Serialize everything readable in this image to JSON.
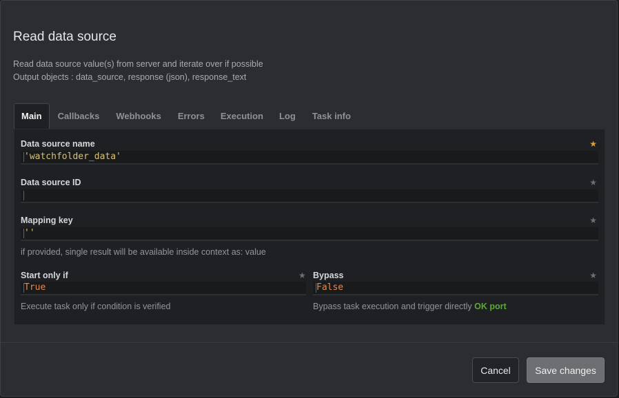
{
  "dialog": {
    "title": "Read data source",
    "description_line1": "Read data source value(s) from server and iterate over if possible",
    "description_line2": "Output objects : data_source, response (json), response_text"
  },
  "tabs": [
    "Main",
    "Callbacks",
    "Webhooks",
    "Errors",
    "Execution",
    "Log",
    "Task info"
  ],
  "fields": {
    "data_source_name": {
      "label": "Data source name",
      "value": "'watchfolder_data'"
    },
    "data_source_id": {
      "label": "Data source ID",
      "value": ""
    },
    "mapping_key": {
      "label": "Mapping key",
      "value": "''",
      "help": "if provided, single result will be available inside context as: value"
    },
    "start_only_if": {
      "label": "Start only if",
      "value": "True",
      "help": "Execute task only if condition is verified"
    },
    "bypass": {
      "label": "Bypass",
      "value": "False",
      "help": "Bypass task execution and trigger directly ",
      "help_highlight": "OK port"
    }
  },
  "icons": {
    "star": "★"
  },
  "colors": {
    "required_star": "#d9a23a",
    "optional_star": "#6c6f75",
    "string_value": "#d8c27a",
    "boolean_value": "#e08a55",
    "ok_port": "#5fa838"
  },
  "buttons": {
    "cancel": "Cancel",
    "save": "Save changes"
  }
}
